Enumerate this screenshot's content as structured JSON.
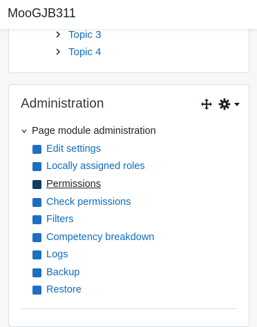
{
  "header": {
    "site_name": "MooGJB311"
  },
  "topics": [
    {
      "label": "Topic 3"
    },
    {
      "label": "Topic 4"
    }
  ],
  "admin": {
    "title": "Administration",
    "tools": {
      "move_icon": "move-icon",
      "settings_icon": "gear-icon",
      "caret_icon": "caret-down-icon"
    },
    "section": {
      "label": "Page module administration"
    },
    "items": [
      {
        "label": "Edit settings"
      },
      {
        "label": "Locally assigned roles"
      },
      {
        "label": "Permissions"
      },
      {
        "label": "Check permissions"
      },
      {
        "label": "Filters"
      },
      {
        "label": "Competency breakdown"
      },
      {
        "label": "Logs"
      },
      {
        "label": "Backup"
      },
      {
        "label": "Restore"
      }
    ]
  },
  "colors": {
    "link": "#0f6cbf",
    "icon_square": "#1f6fbf",
    "icon_square_active": "#0b3d66",
    "text": "#1d2125"
  }
}
